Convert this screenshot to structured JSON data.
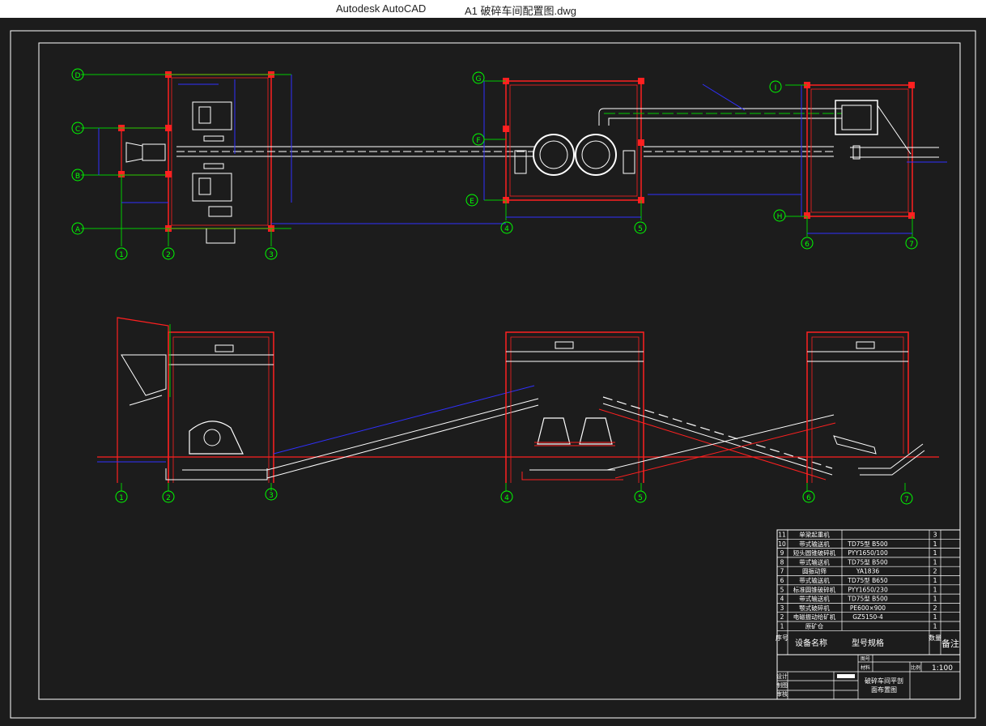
{
  "window": {
    "app_name": "Autodesk AutoCAD",
    "file_name": "A1  破碎车间配置图.dwg"
  },
  "drawing": {
    "colors": {
      "background": "#1c1c1c",
      "frame": "#ffffff",
      "wall": "#ff2020",
      "grid_bubble": "#00ff00",
      "dimension": "#3030ff",
      "centerline": "#00cc00",
      "equipment": "#ffffff"
    },
    "grid_plan_left": [
      "D",
      "C",
      "B",
      "A"
    ],
    "grid_plan_mid": [
      "G",
      "F",
      "E"
    ],
    "grid_plan_right": [
      "I",
      "H"
    ],
    "grid_columns": [
      "1",
      "2",
      "3",
      "4",
      "5",
      "6",
      "7"
    ]
  },
  "equipment_table": {
    "rows": [
      {
        "no": "11",
        "name": "单梁起重机",
        "model": "",
        "qty": "3",
        "note": ""
      },
      {
        "no": "10",
        "name": "带式输送机",
        "model": "TD75型 B500",
        "qty": "1",
        "note": ""
      },
      {
        "no": "9",
        "name": "短头圆锥破碎机",
        "model": "PYY1650/100",
        "qty": "1",
        "note": ""
      },
      {
        "no": "8",
        "name": "带式输送机",
        "model": "TD75型 B500",
        "qty": "1",
        "note": ""
      },
      {
        "no": "7",
        "name": "圆振动筛",
        "model": "YA1836",
        "qty": "2",
        "note": ""
      },
      {
        "no": "6",
        "name": "带式输送机",
        "model": "TD75型 B650",
        "qty": "1",
        "note": ""
      },
      {
        "no": "5",
        "name": "标准圆锥破碎机",
        "model": "PYY1650/230",
        "qty": "1",
        "note": ""
      },
      {
        "no": "4",
        "name": "带式输送机",
        "model": "TD75型 B500",
        "qty": "1",
        "note": ""
      },
      {
        "no": "3",
        "name": "颚式破碎机",
        "model": "PE600×900",
        "qty": "2",
        "note": ""
      },
      {
        "no": "2",
        "name": "电磁振动给矿机",
        "model": "GZ5150-4",
        "qty": "1",
        "note": ""
      },
      {
        "no": "1",
        "name": "原矿仓",
        "model": "",
        "qty": "1",
        "note": ""
      }
    ],
    "header": {
      "no": "序号",
      "name": "设备名称",
      "model": "型号规格",
      "qty": "数量",
      "note": "备注"
    }
  },
  "title_block": {
    "title_line1": "破碎车间平剖",
    "title_line2": "面布置图",
    "scale": "1:100",
    "scale_label": "比例",
    "row_labels": [
      "设计",
      "制图",
      "审核"
    ],
    "mini_labels": [
      "图号",
      "材料"
    ]
  }
}
